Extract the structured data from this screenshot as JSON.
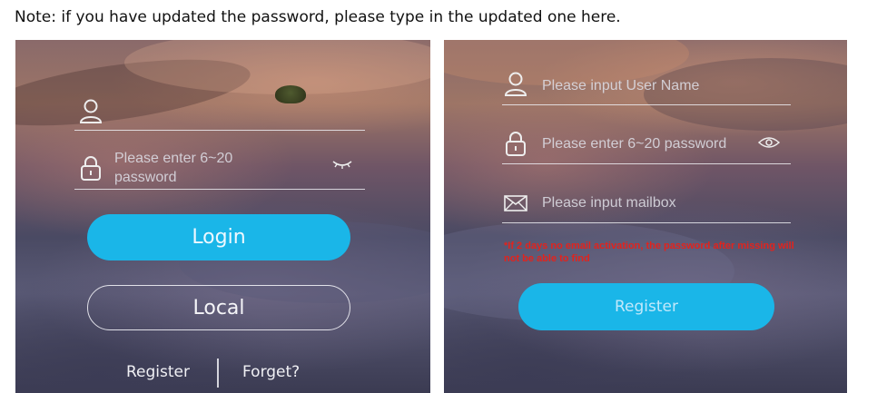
{
  "note": "Note: if you have updated the password, please type in the updated one here.",
  "login_screen": {
    "username_value": "",
    "password_placeholder": "Please enter 6~20\npassword",
    "login_label": "Login",
    "local_label": "Local",
    "register_link": "Register",
    "forget_link": "Forget?"
  },
  "register_screen": {
    "username_placeholder": "Please input User Name",
    "password_placeholder": "Please enter 6~20 password",
    "mailbox_placeholder": "Please input mailbox",
    "warning": "*If 2 days no email activation, the password after missing will not be able to find",
    "register_label": "Register"
  },
  "colors": {
    "button_blue": "#1ab6e8",
    "warning_red": "#e2231d"
  },
  "icons": {
    "user": "user-icon",
    "lock": "lock-icon",
    "eye_closed": "eye-closed-icon",
    "eye_open": "eye-open-icon",
    "mail": "mail-icon"
  }
}
